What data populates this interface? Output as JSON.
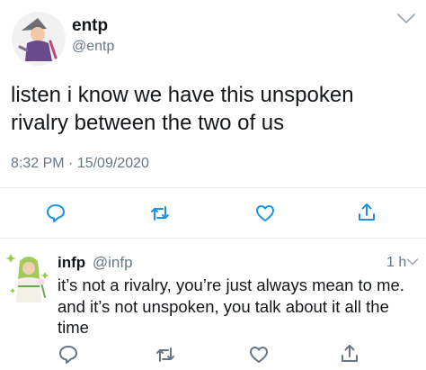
{
  "main_tweet": {
    "display_name": "entp",
    "handle": "@entp",
    "text": "listen i know we have this unspoken rivalry between the two of us",
    "timestamp": "8:32 PM · 15/09/2020",
    "actions": [
      "reply-icon",
      "retweet-icon",
      "like-icon",
      "share-icon"
    ]
  },
  "reply_tweet": {
    "display_name": "infp",
    "handle": "@infp",
    "time": "1 h",
    "text": "it’s not a rivalry, you’re just always mean to me. and it’s not unspoken, you talk about it all the time",
    "actions": [
      "reply-icon",
      "retweet-icon",
      "like-icon",
      "share-icon"
    ]
  },
  "colors": {
    "text": "#14171a",
    "secondary": "#657786",
    "icon_blue": "#1b95e0",
    "divider": "#e1e8ed"
  }
}
